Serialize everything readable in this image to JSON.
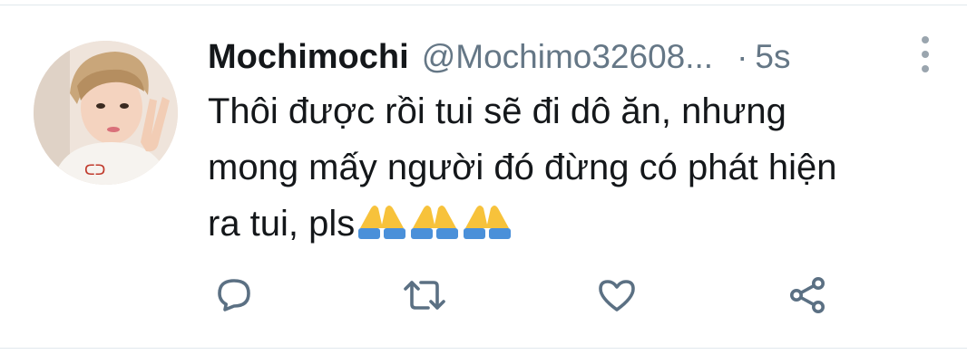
{
  "tweet": {
    "display_name": "Mochimochi",
    "handle": "@Mochimo32608...",
    "separator": "·",
    "timestamp": "5s",
    "text_lines": [
      "Thôi được rồi tui sẽ đi dô ăn, nhưng",
      "mong mấy người đó đừng có phát hiện",
      "ra tui, pls"
    ],
    "emoji": [
      "folded-hands",
      "folded-hands",
      "folded-hands"
    ]
  },
  "actions": {
    "reply_icon": "reply-icon",
    "retweet_icon": "retweet-icon",
    "like_icon": "heart-icon",
    "share_icon": "share-icon",
    "more_icon": "more-vertical-icon"
  },
  "colors": {
    "text_primary": "#14171a",
    "text_secondary": "#657786",
    "icon": "#5b7083",
    "divider": "#e1e8ed",
    "emoji_sleeve": "#4a90d9",
    "emoji_hand": "#f7c23b"
  }
}
